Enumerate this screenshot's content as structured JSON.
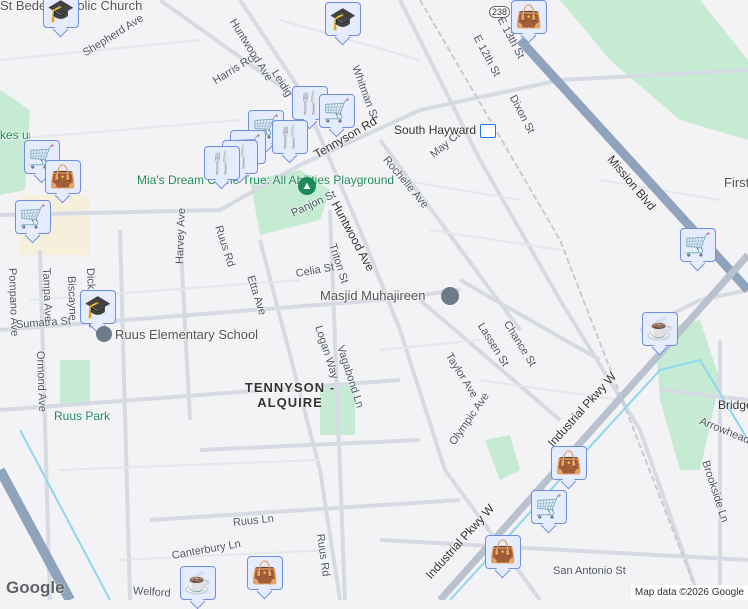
{
  "streets": [
    "Shepherd Ave",
    "Harris Rd",
    "Huntwood Ave",
    "Leidig",
    "Whitman St",
    "Tennyson Rd",
    "E 13th St",
    "E 12th St",
    "Dixon St",
    "Rochelle Ave",
    "May Ct",
    "Mission Blvd",
    "Panjon St",
    "Huntwood Ave",
    "Triton St",
    "Celia St",
    "Ruus Rd",
    "Harvey Ave",
    "Etta Ave",
    "Dickens Ave",
    "Tampa Ave",
    "Biscayne",
    "Pompano Ave",
    "Ormond Ave",
    "Sumatra St",
    "Logan Way",
    "Vagabond Ln",
    "Lassen St",
    "Chance St",
    "Taylor Ave",
    "Olympic Ave",
    "Industrial Pkwy W",
    "Industrial Pkwy W",
    "Bridge",
    "Arrowhead Way",
    "Brookside Ln",
    "San Antonio St",
    "Ruus Ln",
    "Canterbury Ln",
    "Welford",
    "Ruus Rd"
  ],
  "pois": {
    "church": "St Bede Catholic Church",
    "playground": "Mia's Dream Come True: All Abilities Playground",
    "mosque": "Masjid Muhajireen",
    "school": "Ruus Elementary School",
    "park": "Ruus Park",
    "station": "South Hayward",
    "first": "First",
    "kes": "kes unity Par"
  },
  "neighborhood": "TENNYSON - ALQUIRE",
  "route_shield": "238",
  "markers": [
    "school",
    "school",
    "shopping-bag",
    "shopping-cart",
    "coffee",
    "shopping-bag",
    "shopping-cart",
    "shopping-bag",
    "coffee",
    "shopping-bag",
    "shopping-cart",
    "shopping-bag",
    "restaurant",
    "restaurant",
    "restaurant",
    "shopping-cart",
    "school"
  ],
  "attribution": "Map data ©2026 Google",
  "logo": "Google",
  "colors": {
    "marker_bg": "#e5ecfd",
    "marker_icon": "#0b4266",
    "park": "#c5ebd2",
    "highway": "#8fa3bd"
  }
}
